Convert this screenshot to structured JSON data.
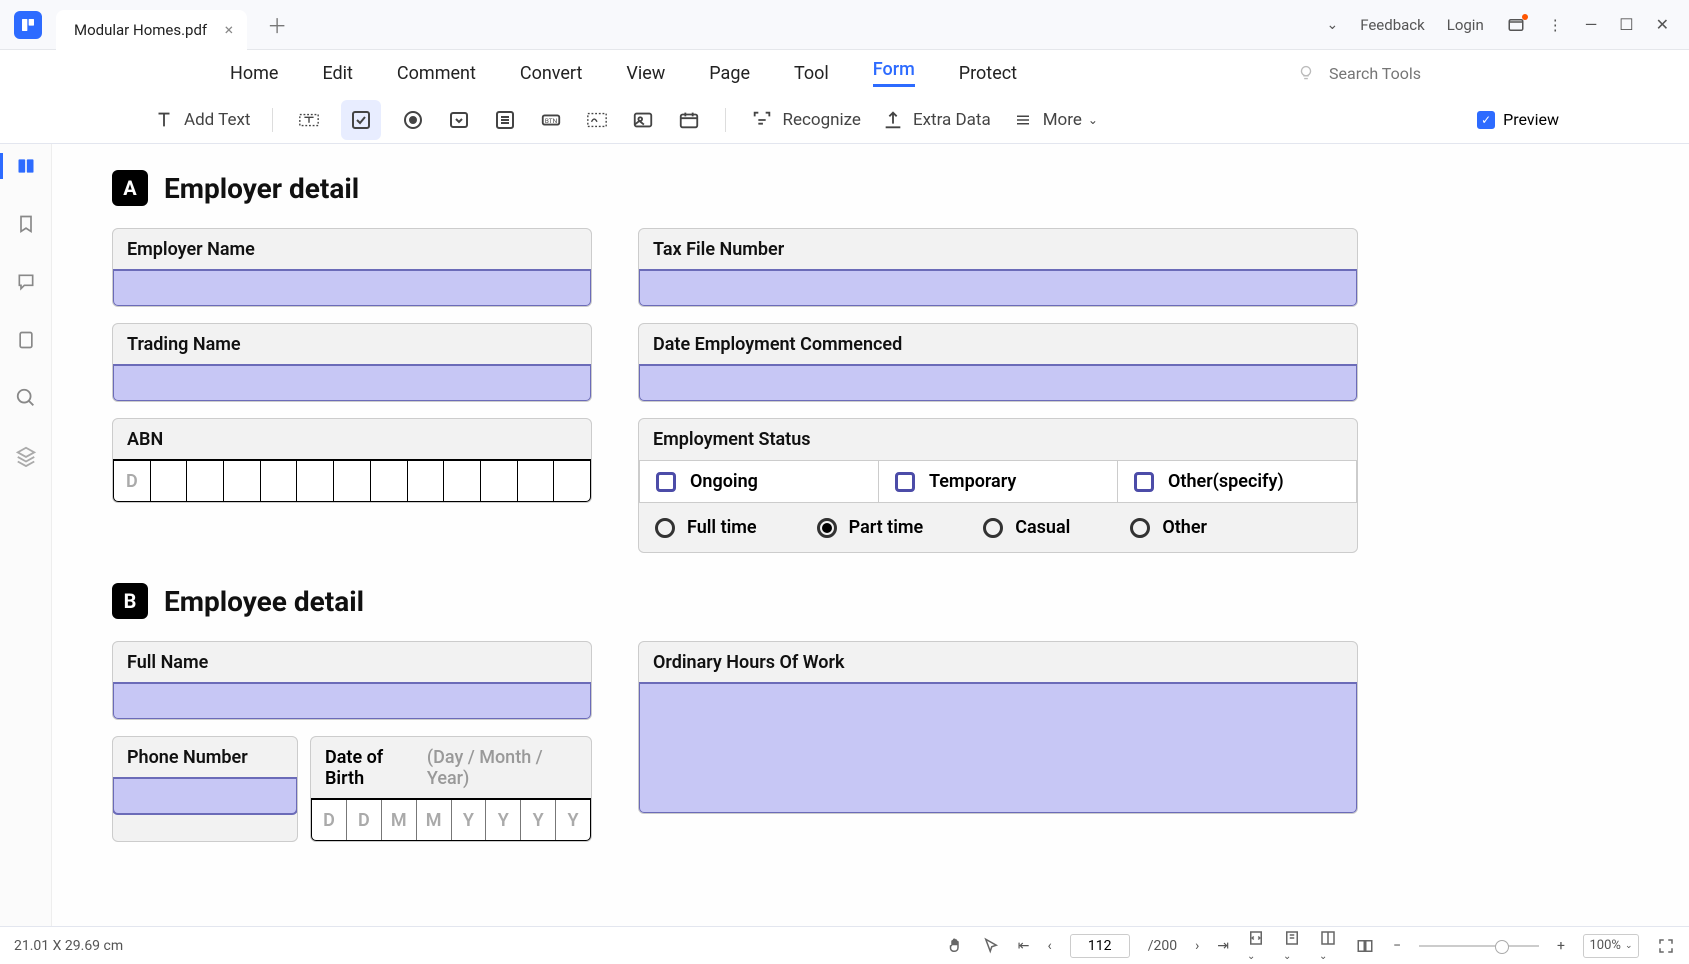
{
  "titlebar": {
    "filename": "Modular Homes.pdf",
    "feedback": "Feedback",
    "login": "Login"
  },
  "menu": {
    "items": [
      "Home",
      "Edit",
      "Comment",
      "Convert",
      "View",
      "Page",
      "Tool",
      "Form",
      "Protect"
    ],
    "active_index": 7,
    "search_placeholder": "Search Tools"
  },
  "toolbar": {
    "add_text": "Add Text",
    "recognize": "Recognize",
    "extra_data": "Extra Data",
    "more": "More",
    "preview": "Preview"
  },
  "form": {
    "section_a": {
      "badge": "A",
      "title": "Employer detail"
    },
    "section_b": {
      "badge": "B",
      "title": "Employee detail"
    },
    "employer_name": "Employer Name",
    "trading_name": "Trading Name",
    "abn": "ABN",
    "abn_cells": [
      "D",
      "",
      "",
      "",
      "",
      "",
      "",
      "",
      "",
      "",
      "",
      "",
      ""
    ],
    "tax_file": "Tax File Number",
    "date_commenced": "Date Employment Commenced",
    "emp_status": "Employment Status",
    "status_opts": [
      "Ongoing",
      "Temporary",
      "Other(specify)"
    ],
    "time_opts": [
      "Full time",
      "Part time",
      "Casual",
      "Other"
    ],
    "time_selected_index": 1,
    "full_name": "Full Name",
    "phone": "Phone Number",
    "dob": "Date of Birth",
    "dob_hint": "(Day / Month / Year)",
    "dob_cells": [
      "D",
      "D",
      "M",
      "M",
      "Y",
      "Y",
      "Y",
      "Y"
    ],
    "ord_hours": "Ordinary Hours Of Work"
  },
  "statusbar": {
    "dimensions": "21.01 X 29.69 cm",
    "page_current": "112",
    "page_total": "/200",
    "zoom": "100%"
  }
}
